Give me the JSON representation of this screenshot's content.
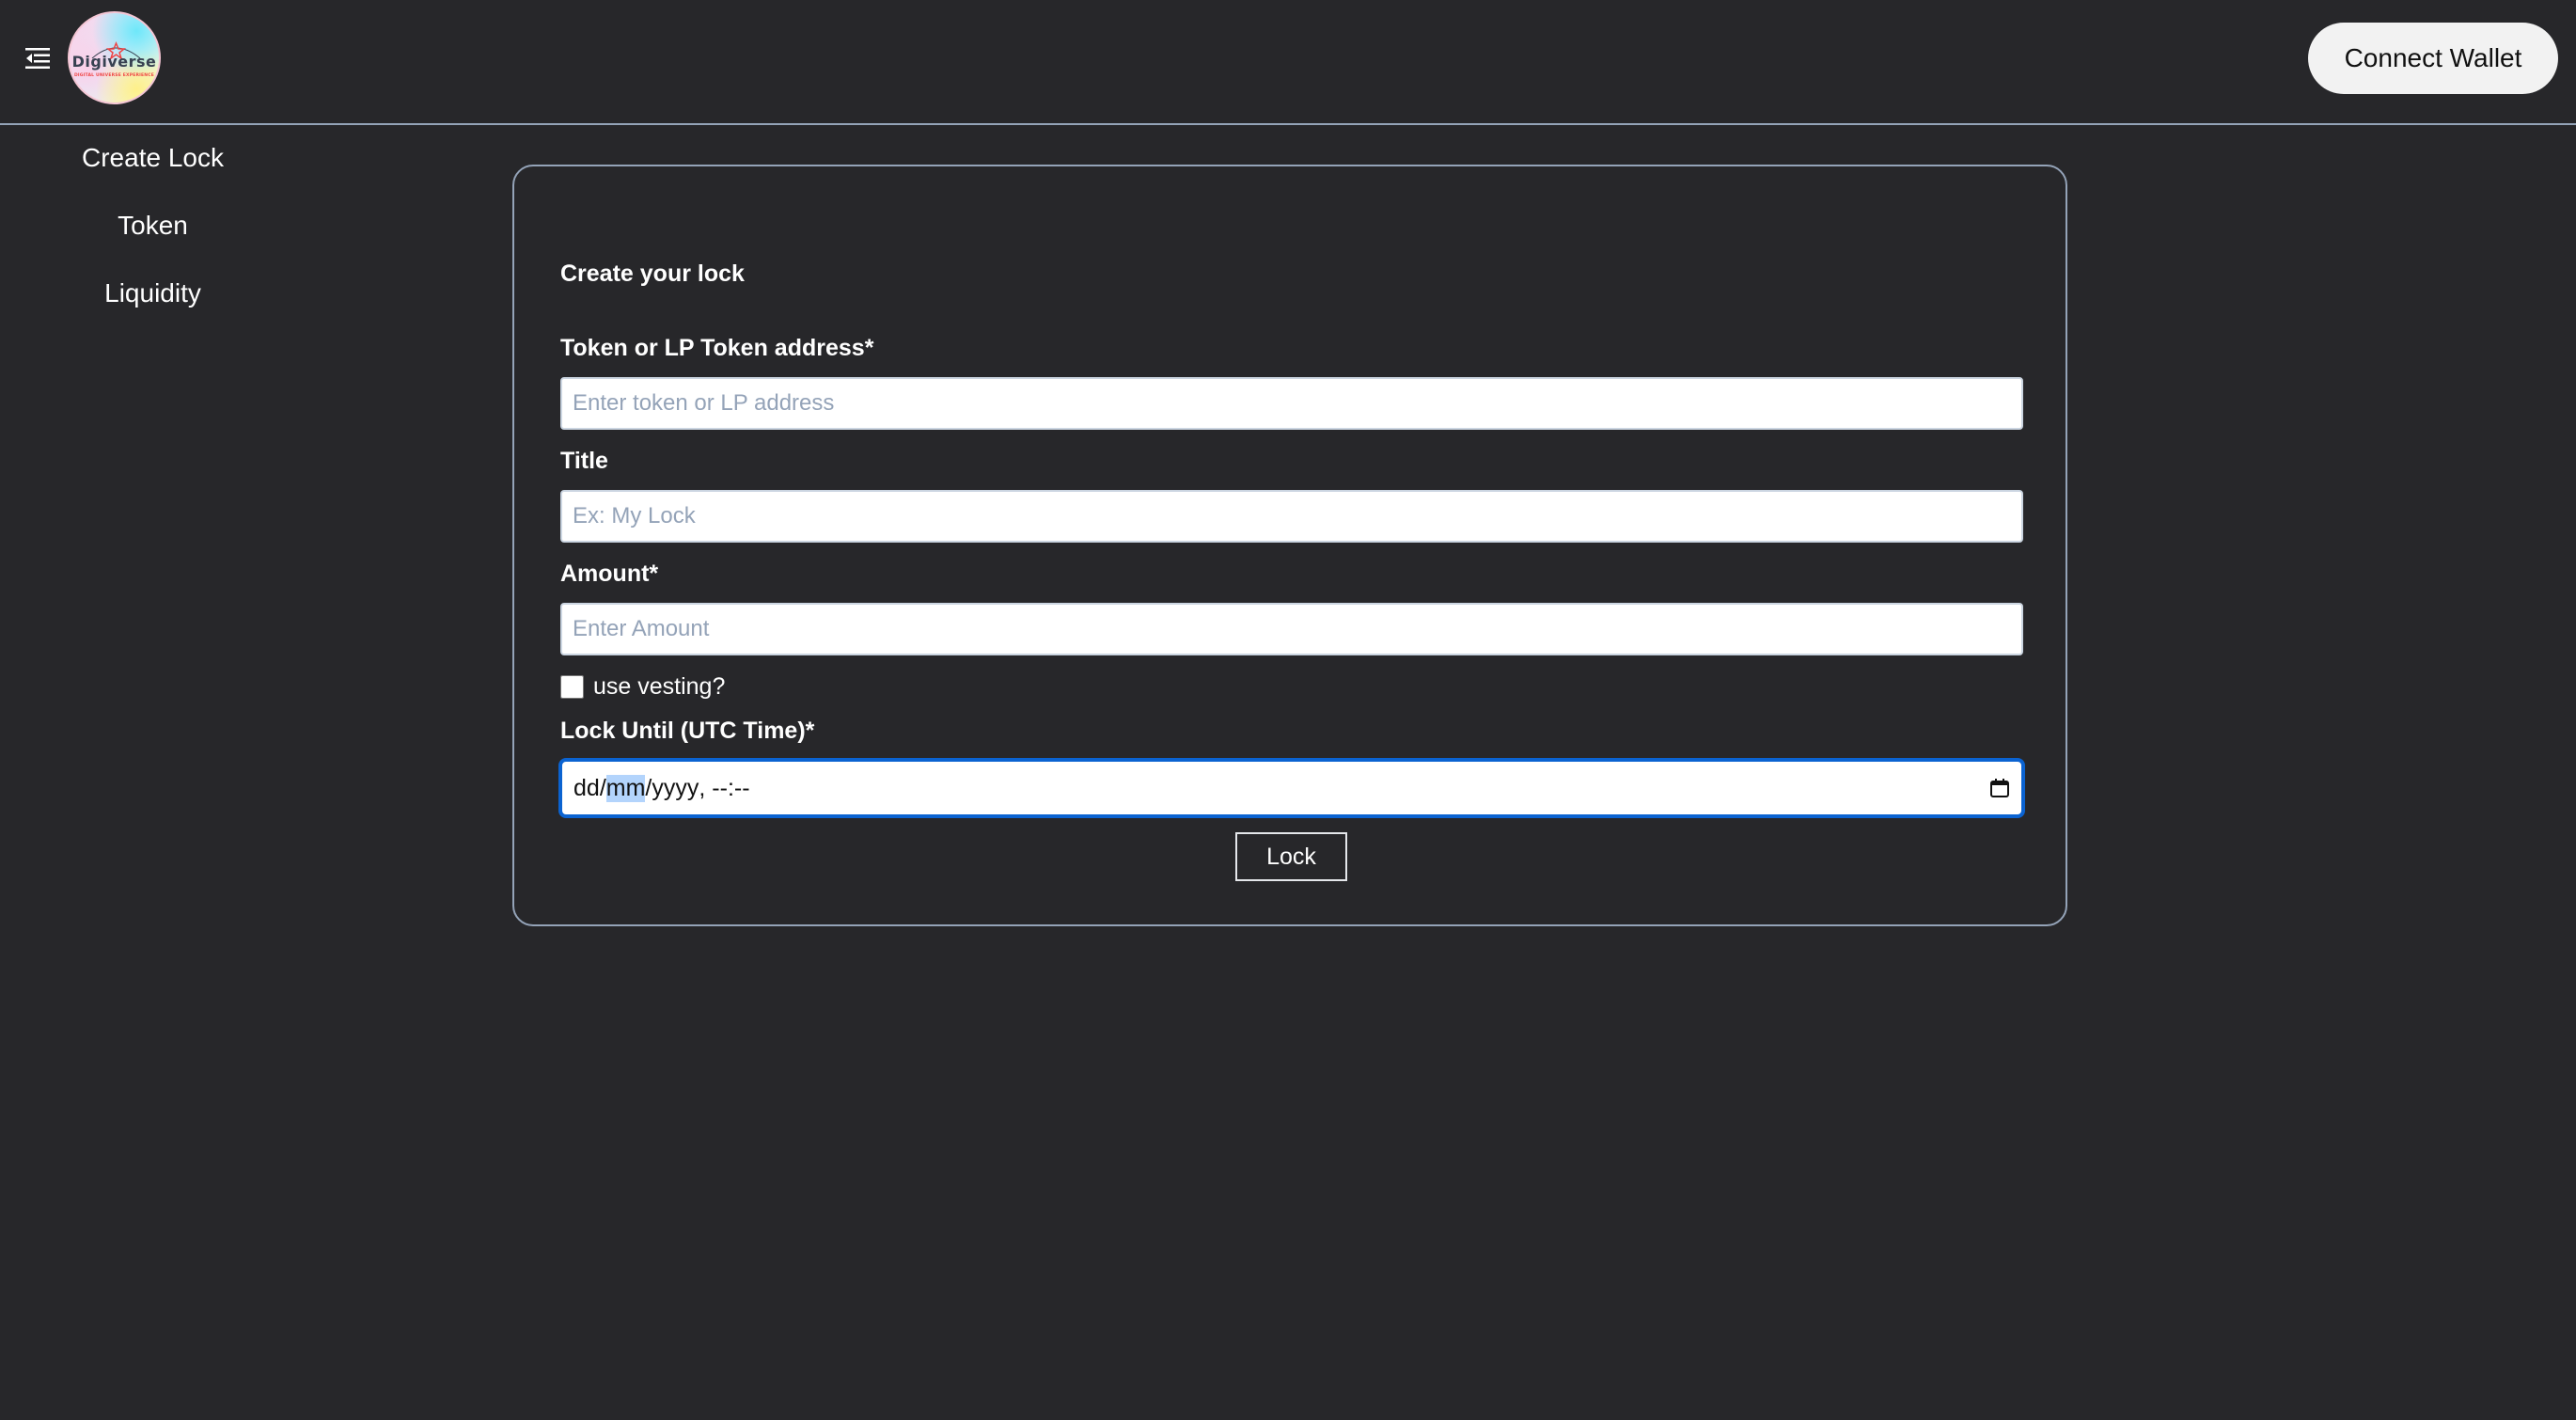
{
  "header": {
    "menu_icon": "menu-collapse-icon",
    "logo": {
      "name": "Digiverse",
      "tagline": "DIGITAL UNIVERSE EXPERIENCE"
    },
    "connect_wallet_label": "Connect Wallet"
  },
  "sidebar": {
    "items": [
      {
        "label": "Create Lock"
      },
      {
        "label": "Token"
      },
      {
        "label": "Liquidity"
      }
    ]
  },
  "form": {
    "title": "Create your lock",
    "token_address": {
      "label": "Token or LP Token address*",
      "placeholder": "Enter token or LP address",
      "value": ""
    },
    "title_field": {
      "label": "Title",
      "placeholder": "Ex: My Lock",
      "value": ""
    },
    "amount": {
      "label": "Amount*",
      "placeholder": "Enter Amount",
      "value": ""
    },
    "use_vesting": {
      "label": "use vesting?",
      "checked": false
    },
    "lock_until": {
      "label": "Lock Until (UTC Time)*",
      "segments": {
        "day": "dd",
        "sep1": "/",
        "month": "mm",
        "sep2": "/",
        "year": "yyyy",
        "sep3": ", ",
        "hour": "--",
        "sep4": ":",
        "minute": "--"
      },
      "focused_segment": "month",
      "icon": "calendar-icon"
    },
    "submit_label": "Lock"
  },
  "colors": {
    "background": "#27272a",
    "border": "#94a3b8",
    "focus": "#0b63d1",
    "placeholder": "#94a3b8",
    "segment_highlight": "#b3d4fc"
  }
}
